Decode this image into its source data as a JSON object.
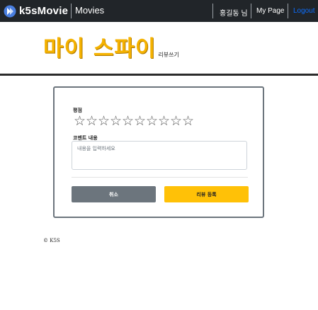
{
  "navbar": {
    "brand": "k5sMovie",
    "movies_link": "Movies",
    "user_greeting": "홍길동 님",
    "mypage_link": "My Page",
    "logout_link": "Logout"
  },
  "header": {
    "movie_title": "마이 스파이",
    "subtitle": "리뷰쓰기"
  },
  "form": {
    "rating_label": "평점",
    "stars": [
      "☆",
      "☆",
      "☆",
      "☆",
      "☆",
      "☆",
      "☆",
      "☆",
      "☆",
      "☆"
    ],
    "comment_label": "코멘트 내용",
    "comment_placeholder": "내용을 입력하세요",
    "cancel_button": "취소",
    "submit_button": "리뷰 등록"
  },
  "footer": {
    "copyright": "© K5S"
  },
  "colors": {
    "navbar_bg": "#212529",
    "accent_gold": "#f5b200",
    "submit_yellow": "#ffc107",
    "cancel_gray": "#6c757d",
    "logout_blue": "#0d6efd"
  }
}
